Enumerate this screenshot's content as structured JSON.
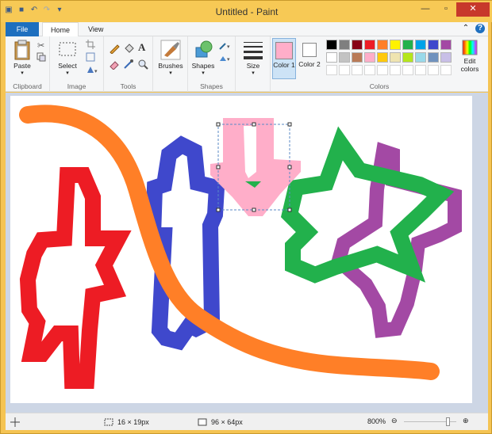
{
  "window": {
    "title": "Untitled - Paint"
  },
  "menu": {
    "file": "File",
    "home": "Home",
    "view": "View"
  },
  "groups": {
    "clipboard": {
      "label": "Clipboard",
      "paste": "Paste"
    },
    "image": {
      "label": "Image",
      "select": "Select"
    },
    "tools": {
      "label": "Tools"
    },
    "shapes": {
      "label": "Shapes",
      "brushes": "Brushes",
      "shapes": "Shapes"
    },
    "size": {
      "label": "Size"
    },
    "colors": {
      "label": "Colors",
      "color1": "Color 1",
      "color2": "Color 2",
      "edit": "Edit colors",
      "color1_value": "#ffaec9",
      "color2_value": "#ffffff",
      "palette_row1": [
        "#000000",
        "#7f7f7f",
        "#880015",
        "#ed1c24",
        "#ff7f27",
        "#fff200",
        "#22b14c",
        "#00a2e8",
        "#3f48cc",
        "#a349a4"
      ],
      "palette_row2": [
        "#ffffff",
        "#c3c3c3",
        "#b97a57",
        "#ffaec9",
        "#ffc90e",
        "#efe4b0",
        "#b5e61d",
        "#99d9ea",
        "#7092be",
        "#c8bfe7"
      ]
    }
  },
  "status": {
    "selection_size": "16 × 19px",
    "canvas_size": "96 × 64px",
    "zoom": "800%",
    "zoom_level": 0.8
  },
  "icons": {
    "move": "move-icon",
    "selection": "selection-size-icon",
    "canvas": "canvas-size-icon"
  }
}
